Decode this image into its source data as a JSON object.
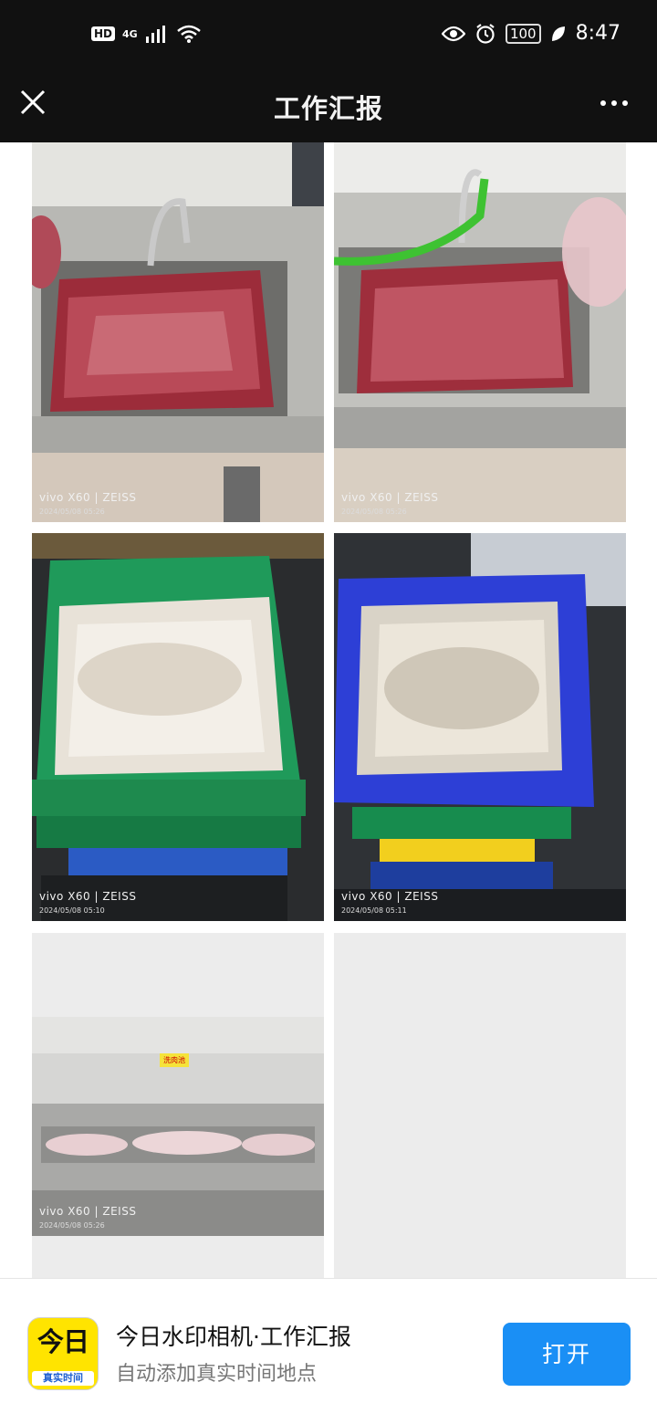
{
  "status_bar": {
    "hd_badge": "HD",
    "network": "4G",
    "battery": "100",
    "time": "8:47",
    "icons": [
      "signal-icon",
      "wifi-icon",
      "eye-icon",
      "alarm-icon",
      "battery-icon",
      "leaf-icon"
    ]
  },
  "nav": {
    "title": "工作汇报",
    "close_icon": "close-icon",
    "more_icon": "more-icon"
  },
  "photos": [
    {
      "brand": "vivo X60 | ZEISS",
      "date": "2024/05/08 05:26"
    },
    {
      "brand": "vivo X60 | ZEISS",
      "date": "2024/05/08 05:26"
    },
    {
      "brand": "vivo X60 | ZEISS",
      "date": "2024/05/08 05:10"
    },
    {
      "brand": "vivo X60 | ZEISS",
      "date": "2024/05/08 05:11"
    },
    {
      "brand": "vivo X60 | ZEISS",
      "date": "2024/05/08 05:26",
      "sign": "洗肉池"
    }
  ],
  "banner": {
    "app_icon_top": "今日",
    "app_icon_sub": "真实时间",
    "title": "今日水印相机·工作汇报",
    "subtitle": "自动添加真实时间地点",
    "open_label": "打开"
  },
  "colors": {
    "open_button": "#1a8ff5",
    "app_icon_bg": "#ffe400",
    "status_bg": "#111111"
  }
}
